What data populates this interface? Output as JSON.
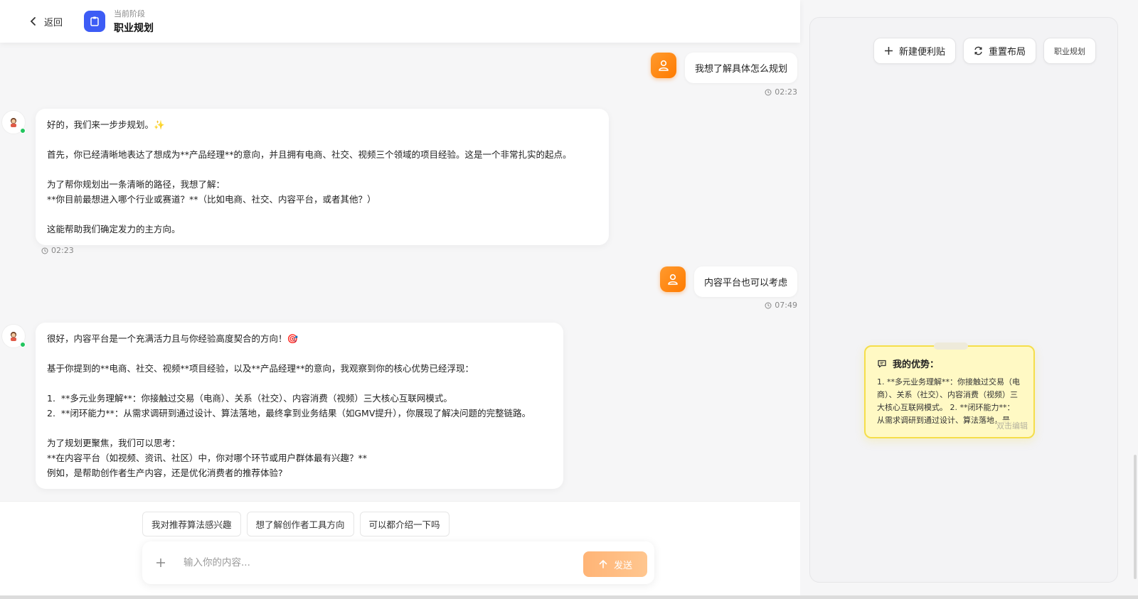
{
  "topbar": {
    "back_label": "返回",
    "stage_label": "当前阶段",
    "stage_title": "职业规划"
  },
  "messages": [
    {
      "role": "user",
      "text": "我想了解具体怎么规划",
      "time": "02:23"
    },
    {
      "role": "ai",
      "paragraphs": [
        "好的，我们来一步步规划。✨",
        "",
        "首先，你已经清晰地表达了想成为**产品经理**的意向，并且拥有电商、社交、视频三个领域的项目经验。这是一个非常扎实的起点。",
        "",
        "为了帮你规划出一条清晰的路径，我想了解：",
        "**你目前最想进入哪个行业或赛道？**（比如电商、社交、内容平台，或者其他？）",
        "",
        "这能帮助我们确定发力的主方向。"
      ],
      "time": "02:23"
    },
    {
      "role": "user",
      "text": "内容平台也可以考虑",
      "time": "07:49"
    },
    {
      "role": "ai",
      "paragraphs": [
        "很好，内容平台是一个充满活力且与你经验高度契合的方向！🎯",
        "",
        "基于你提到的**电商、社交、视频**项目经验，以及**产品经理**的意向，我观察到你的核心优势已经浮现：",
        "",
        "1.  **多元业务理解**：你接触过交易（电商）、关系（社交）、内容消费（视频）三大核心互联网模式。",
        "2.  **闭环能力**：从需求调研到通过设计、算法落地，最终拿到业务结果（如GMV提升），你展现了解决问题的完整链路。",
        "",
        "为了规划更聚焦，我们可以思考：",
        "**在内容平台（如视频、资讯、社区）中，你对哪个环节或用户群体最有兴趣？**",
        "例如，是帮助创作者生产内容，还是优化消费者的推荐体验?"
      ]
    }
  ],
  "suggestions": [
    "我对推荐算法感兴趣",
    "想了解创作者工具方向",
    "可以都介绍一下吗"
  ],
  "input": {
    "placeholder": "输入你的内容...",
    "send_label": "发送"
  },
  "panel": {
    "new_note_label": "新建便利贴",
    "reset_layout_label": "重置布局",
    "tag_label": "职业规划",
    "sticky": {
      "title": "我的优势：",
      "body": "1. **多元业务理解**：你接触过交易（电商）、关系（社交）、内容消费（视频）三大核心互联网模式。 2. **闭环能力**：从需求调研到通过设计、算法落地，最...",
      "hint": "双击编辑"
    }
  },
  "colors": {
    "accent": "#3d5cf5",
    "user_avatar": "#ff7b00",
    "send": "#ffb476",
    "sticky": "#fff9c4",
    "online": "#22c55e"
  }
}
